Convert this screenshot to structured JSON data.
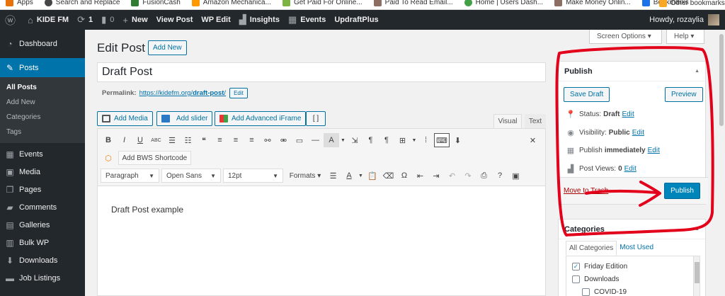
{
  "bookmarks": [
    {
      "label": "Apps",
      "icon": "apps-grid-icon",
      "color": "#e8710a"
    },
    {
      "label": "Search and Replace",
      "icon": "wordpress-icon",
      "color": "#464646"
    },
    {
      "label": "FusionCash",
      "icon": "fusioncash-icon",
      "color": "#2e7d32"
    },
    {
      "label": "Amazon Mechanica...",
      "icon": "amazon-icon",
      "color": "#ff9900"
    },
    {
      "label": "Get Paid For Online...",
      "icon": "leaf-icon",
      "color": "#7cb342"
    },
    {
      "label": "Paid To Read Email...",
      "icon": "page-icon",
      "color": "#8d6e63"
    },
    {
      "label": "Home | Users Dash...",
      "icon": "globe-icon",
      "color": "#43a047"
    },
    {
      "label": "Make Money Onlin...",
      "icon": "page-icon",
      "color": "#8d6e63"
    },
    {
      "label": "Bookmarks",
      "icon": "star-icon",
      "color": "#1a73e8"
    },
    {
      "label": "Other bookmarks",
      "icon": "folder-icon",
      "color": "#f9a825"
    }
  ],
  "adminbar": {
    "site": "KIDE FM",
    "updates": "1",
    "comments": "0",
    "new": "New",
    "view_post": "View Post",
    "wp_edit": "WP Edit",
    "insights": "Insights",
    "events": "Events",
    "updraft": "UpdraftPlus",
    "howdy": "Howdy, rozaylia"
  },
  "sidebar": {
    "dashboard": "Dashboard",
    "posts": "Posts",
    "sub": [
      "All Posts",
      "Add New",
      "Categories",
      "Tags"
    ],
    "events": "Events",
    "media": "Media",
    "pages": "Pages",
    "comments": "Comments",
    "galleries": "Galleries",
    "bulk": "Bulk WP",
    "downloads": "Downloads",
    "jobs": "Job Listings"
  },
  "screen_options": "Screen Options ▾",
  "help": "Help ▾",
  "main": {
    "title": "Edit Post",
    "add_new": "Add New",
    "post_title": "Draft Post",
    "permalink_label": "Permalink:",
    "permalink_base": "https://kidefm.org/",
    "permalink_slug": "draft-post",
    "permalink_end": "/",
    "permalink_edit": "Edit",
    "add_media": "Add Media",
    "add_slider": "Add slider",
    "add_iframe": "Add Advanced iFrame",
    "bracket": "[ ]",
    "tab_visual": "Visual",
    "tab_text": "Text",
    "bws": "Add BWS Shortcode",
    "paragraph": "Paragraph",
    "font": "Open Sans",
    "size": "12pt",
    "formats": "Formats",
    "content": "Draft Post example"
  },
  "publish": {
    "heading": "Publish",
    "save_draft": "Save Draft",
    "preview": "Preview",
    "status_label": "Status:",
    "status_value": "Draft",
    "visibility_label": "Visibility:",
    "visibility_value": "Public",
    "publish_label": "Publish",
    "publish_value": "immediately",
    "views_label": "Post Views:",
    "views_value": "0",
    "edit": "Edit",
    "trash": "Move to Trash",
    "publish_button": "Publish"
  },
  "categories": {
    "heading": "Categories",
    "tab_all": "All Categories",
    "tab_used": "Most Used",
    "items": [
      {
        "label": "Friday Edition",
        "checked": "✓"
      },
      {
        "label": "Downloads",
        "checked": ""
      },
      {
        "label": "COVID-19",
        "checked": ""
      }
    ]
  },
  "colors": {
    "admin_dark": "#23282d",
    "wp_blue": "#0073aa",
    "annotation_red": "#e3001b"
  }
}
